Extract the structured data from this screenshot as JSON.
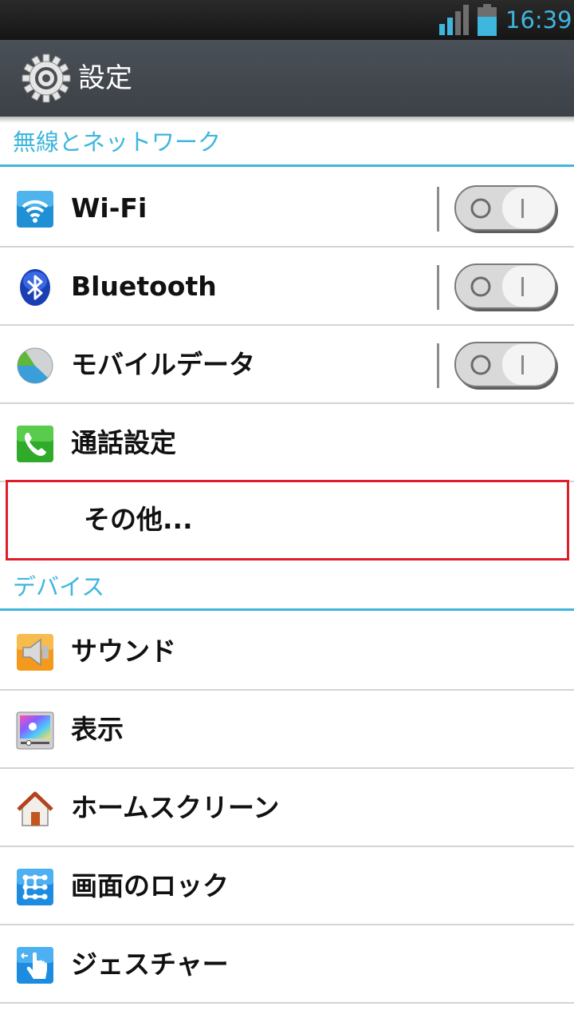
{
  "status_bar": {
    "time": "16:39"
  },
  "header": {
    "title": "設定"
  },
  "sections": {
    "wireless": {
      "title": "無線とネットワーク",
      "items": {
        "wifi": {
          "label": "Wi-Fi",
          "toggle": "off"
        },
        "bluetooth": {
          "label": "Bluetooth",
          "toggle": "off"
        },
        "mobile_data": {
          "label": "モバイルデータ",
          "toggle": "off"
        },
        "call_settings": {
          "label": "通話設定"
        },
        "other": {
          "label": "その他..."
        }
      }
    },
    "device": {
      "title": "デバイス",
      "items": {
        "sound": {
          "label": "サウンド"
        },
        "display": {
          "label": "表示"
        },
        "home_screen": {
          "label": "ホームスクリーン"
        },
        "lock_screen": {
          "label": "画面のロック"
        },
        "gesture": {
          "label": "ジェスチャー"
        }
      }
    }
  },
  "colors": {
    "accent": "#3fb6dd",
    "highlight_border": "#e01e2a",
    "action_bar": "#43484e"
  }
}
